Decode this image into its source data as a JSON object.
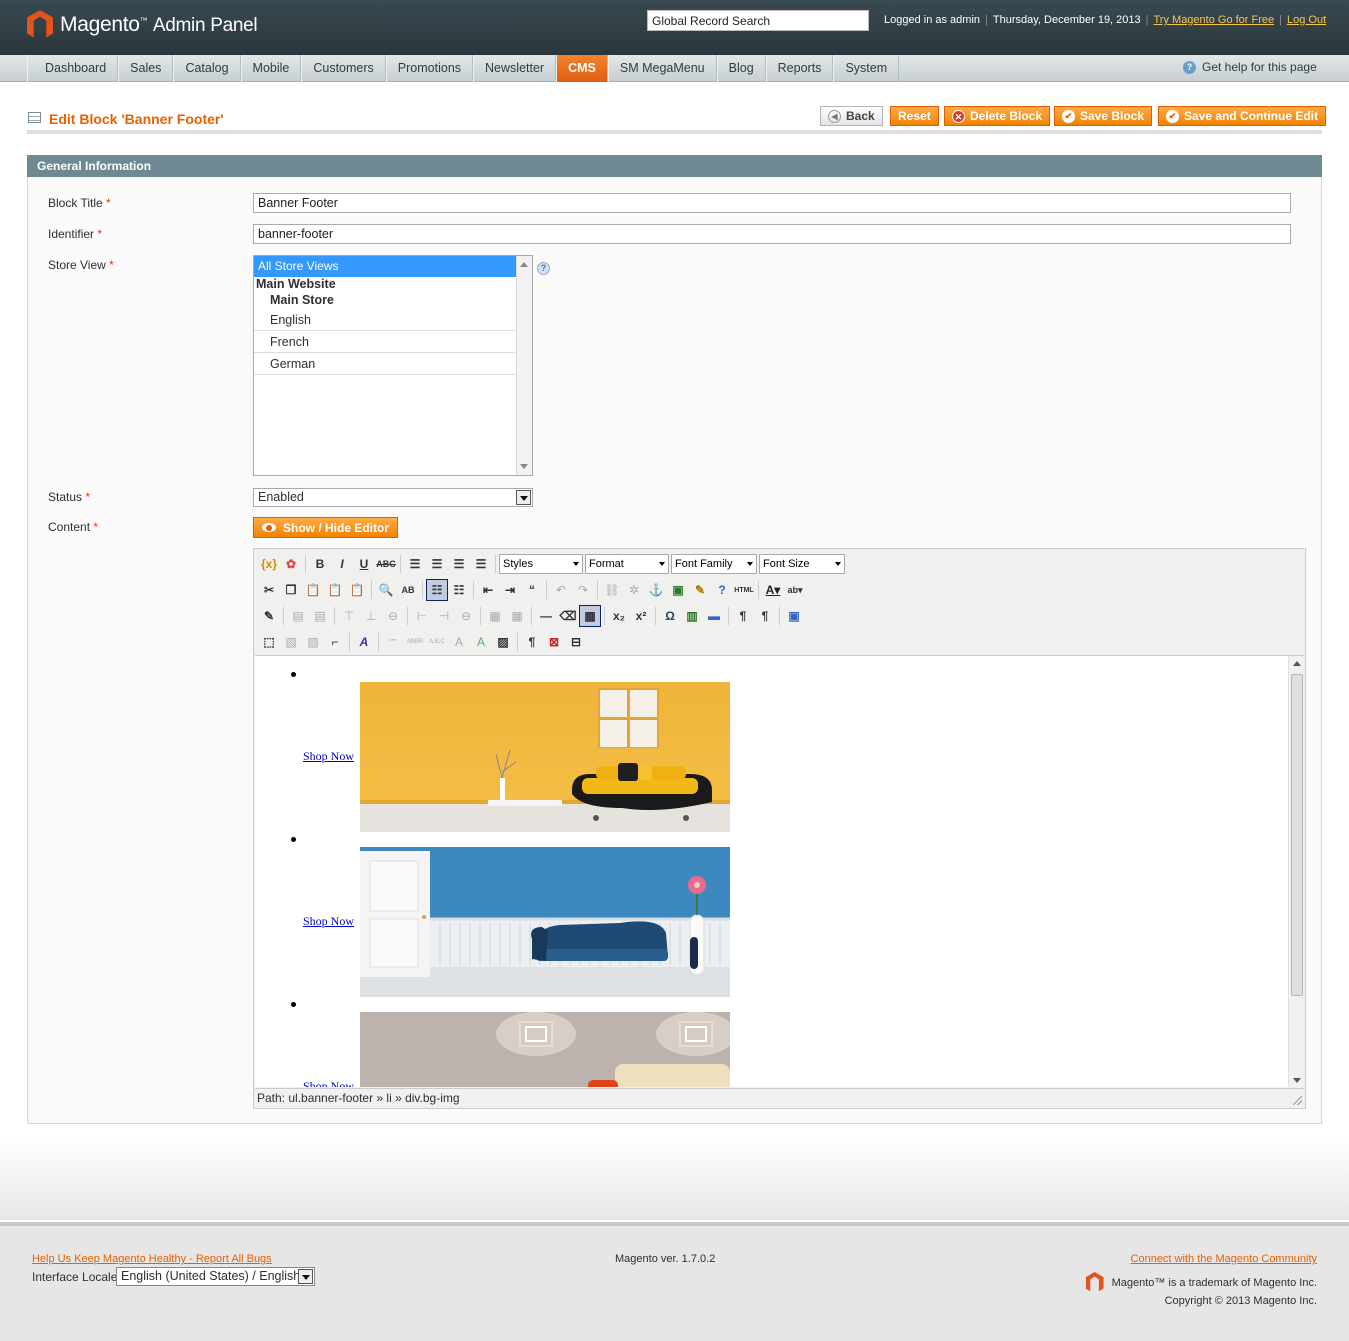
{
  "header": {
    "logo_main": "Magento",
    "logo_sub": "Admin Panel",
    "search_value": "Global Record Search",
    "logged_in": "Logged in as admin",
    "date": "Thursday, December 19, 2013",
    "try_link": "Try Magento Go for Free",
    "logout": "Log Out"
  },
  "nav": {
    "items": [
      "Dashboard",
      "Sales",
      "Catalog",
      "Mobile",
      "Customers",
      "Promotions",
      "Newsletter",
      "CMS",
      "SM MegaMenu",
      "Blog",
      "Reports",
      "System"
    ],
    "active": "CMS",
    "help": "Get help for this page"
  },
  "page": {
    "title": "Edit Block 'Banner Footer'",
    "buttons": {
      "back": "Back",
      "reset": "Reset",
      "delete": "Delete Block",
      "save": "Save Block",
      "save_continue": "Save and Continue Edit"
    }
  },
  "form": {
    "section_title": "General Information",
    "block_title_label": "Block Title",
    "block_title_value": "Banner Footer",
    "identifier_label": "Identifier",
    "identifier_value": "banner-footer",
    "store_view_label": "Store View",
    "store_views": {
      "selected": "All Store Views",
      "website": "Main Website",
      "store": "Main Store",
      "views": [
        "English",
        "French",
        "German"
      ]
    },
    "status_label": "Status",
    "status_value": "Enabled",
    "content_label": "Content",
    "show_hide": "Show / Hide Editor",
    "required": "*"
  },
  "editor": {
    "selects": {
      "styles": "Styles",
      "format": "Format",
      "font_family": "Font Family",
      "font_size": "Font Size"
    },
    "links": [
      "Shop Now",
      "Shop Now",
      "Shop Now"
    ],
    "path": "Path: ul.banner-footer » li » div.bg-img"
  },
  "footer": {
    "bugs": "Help Us Keep Magento Healthy - Report All Bugs",
    "locale_label": "Interface Locale:",
    "locale_value": "English (United States) / English",
    "version": "Magento ver. 1.7.0.2",
    "connect": "Connect with the Magento Community",
    "trademark": "Magento™ is a trademark of Magento Inc.",
    "copyright": "Copyright © 2013 Magento Inc."
  },
  "colors": {
    "accent": "#eb5e00",
    "nav_active": "#f18200",
    "header_bg": "#2f3c42",
    "section_head": "#6f8992",
    "link": "#0000cc"
  }
}
